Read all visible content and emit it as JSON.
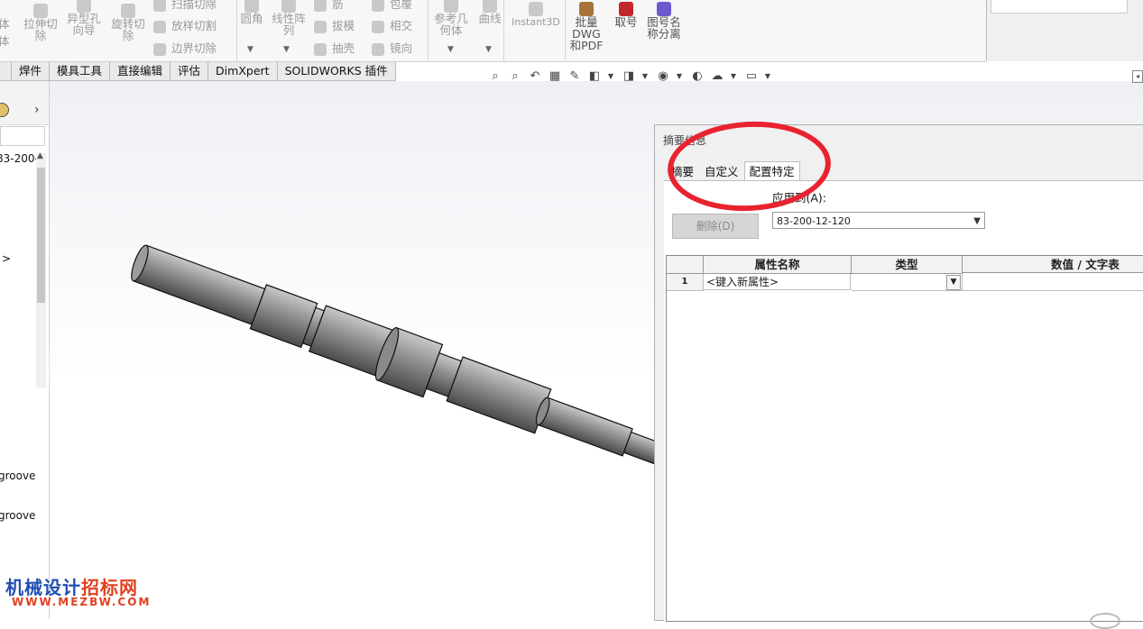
{
  "ribbon": {
    "features": {
      "partial": [
        "体",
        "体"
      ],
      "extrude_cut": "拉伸切除",
      "hole_wizard": "异型孔向导",
      "revolve_cut": "旋转切除",
      "sweep_cut": "扫描切除",
      "loft_cut": "放样切割",
      "boundary_cut": "边界切除",
      "fillet": "圆角",
      "linear_pattern": "线性阵列",
      "rib": "筋",
      "draft": "拔模",
      "shell": "抽壳",
      "wrap": "包覆",
      "intersect": "相交",
      "mirror": "镜向",
      "ref_geometry": "参考几何体",
      "curves": "曲线",
      "instant3d": "Instant3D"
    },
    "addins": {
      "batch_export": "批量DWG和PDF",
      "take_number": "取号",
      "split_drawing_name": "图号名称分离"
    }
  },
  "command_tabs": [
    "焊件",
    "模具工具",
    "直接编辑",
    "评估",
    "DimXpert",
    "SOLIDWORKS 插件"
  ],
  "view_toolbar": [
    "zoom-to-fit-icon",
    "zoom-to-area-icon",
    "previous-view-icon",
    "section-view-icon",
    "dynamic-annotation-icon",
    "view-orientation-icon",
    "display-style-icon",
    "hide-show-icon",
    "edit-appearance-icon",
    "apply-scene-icon",
    "view-settings-icon"
  ],
  "tree": {
    "item_partial": "83-200-",
    "marker": ">",
    "groove1": "groove",
    "groove2": "groove"
  },
  "dialog": {
    "title": "摘要信息",
    "tabs": [
      "摘要",
      "自定义",
      "配置特定"
    ],
    "selected_tab": "配置特定",
    "apply_to_label": "应用到(A):",
    "delete_button": "删除(D)",
    "config_value": "83-200-12-120",
    "grid": {
      "headers": [
        "属性名称",
        "类型",
        "数值 / 文字表"
      ],
      "rows": [
        {
          "num": "1",
          "name": "<键入新属性>",
          "type": "",
          "value": ""
        }
      ]
    }
  },
  "watermark": {
    "line1_a": "机械设计",
    "line1_b": "招标网",
    "line2": "WWW.MEZBW.COM"
  },
  "colors": {
    "annotation": "#e8232f",
    "watermark_blue": "#1f4fb0",
    "watermark_red": "#e04020"
  }
}
